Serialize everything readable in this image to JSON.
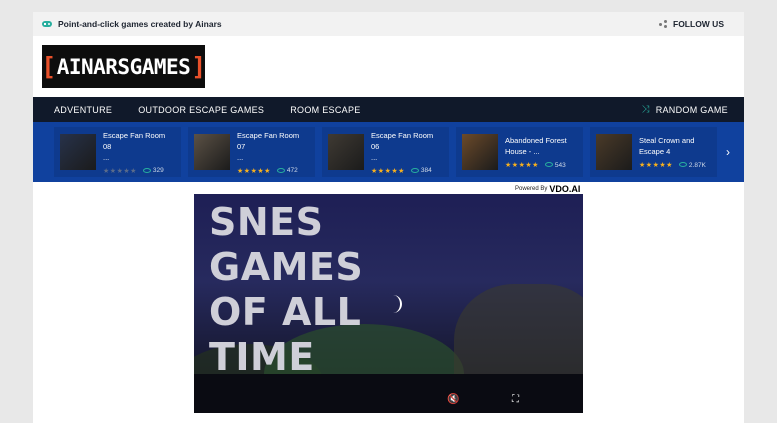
{
  "topbar": {
    "tagline": "Point-and-click games created by Ainars",
    "follow_label": "FOLLOW US"
  },
  "logo": {
    "left_bracket": "[",
    "text": "AINARSGAMES",
    "right_bracket": "]"
  },
  "nav": {
    "items": [
      {
        "label": "ADVENTURE"
      },
      {
        "label": "OUTDOOR ESCAPE GAMES"
      },
      {
        "label": "ROOM ESCAPE"
      }
    ],
    "random_label": "RANDOM GAME"
  },
  "strip": {
    "cards": [
      {
        "title_line1": "Escape Fan Room 08",
        "title_line2": "...",
        "rating": 0,
        "views": "329",
        "thumb_color": "#27324a"
      },
      {
        "title_line1": "Escape Fan Room 07",
        "title_line2": "...",
        "rating": 5,
        "views": "472",
        "thumb_color": "#5b5145"
      },
      {
        "title_line1": "Escape Fan Room 06",
        "title_line2": "...",
        "rating": 5,
        "views": "384",
        "thumb_color": "#3f3a33"
      },
      {
        "title_line1": "Abandoned Forest",
        "title_line2": "House - ...",
        "rating": 5,
        "views": "543",
        "thumb_color": "#6b4a2a"
      },
      {
        "title_line1": "Steal Crown and",
        "title_line2": "Escape 4",
        "rating": 4.5,
        "views": "2.87K",
        "thumb_color": "#4a3a28"
      }
    ]
  },
  "powered": {
    "prefix": "Powered By",
    "brand": "VDO.AI"
  },
  "video": {
    "overlay_lines": [
      "SNES",
      "GAMES",
      "OF ALL",
      "TIME"
    ]
  },
  "colors": {
    "nav_bg": "#10192a",
    "strip_bg": "#10419e",
    "accent": "#27ae9e",
    "logo_bracket": "#e8502a",
    "star": "#f6b01e"
  }
}
